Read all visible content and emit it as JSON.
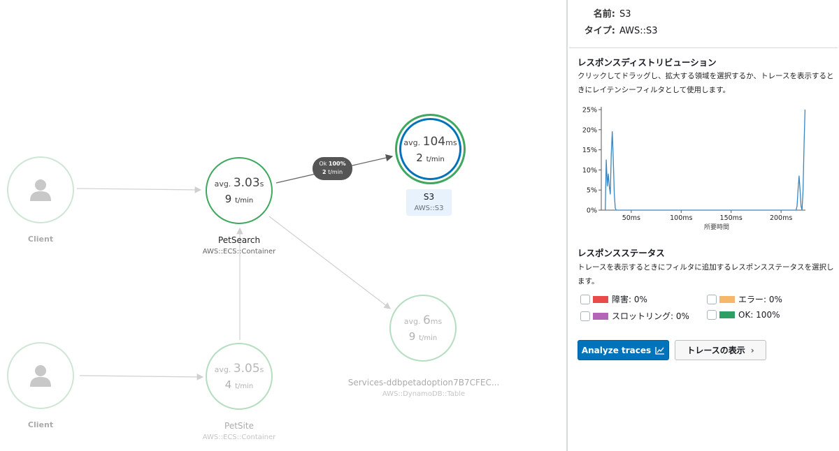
{
  "service_map": {
    "nodes": [
      {
        "id": "client1",
        "name": "Client",
        "kind": "client"
      },
      {
        "id": "petsearch",
        "name": "PetSearch",
        "type": "AWS::ECS::Container",
        "avg_value": "3.03",
        "avg_unit": "s",
        "tpm": "9",
        "tpm_unit": "t/min"
      },
      {
        "id": "s3",
        "name": "S3",
        "type": "AWS::S3",
        "avg_value": "104",
        "avg_unit": "ms",
        "tpm": "2",
        "tpm_unit": "t/min",
        "selected": true
      },
      {
        "id": "client2",
        "name": "Client",
        "kind": "client"
      },
      {
        "id": "petsite",
        "name": "PetSite",
        "type": "AWS::ECS::Container",
        "avg_value": "3.05",
        "avg_unit": "s",
        "tpm": "4",
        "tpm_unit": "t/min"
      },
      {
        "id": "ddb",
        "name": "Services-ddbpetadoption7B7CFEC...",
        "type": "AWS::DynamoDB::Table",
        "avg_value": "6",
        "avg_unit": "ms",
        "tpm": "9",
        "tpm_unit": "t/min"
      }
    ],
    "avg_prefix": "avg.",
    "edge_badge": {
      "status": "Ok",
      "percent": "100%",
      "rate": "2",
      "rate_unit": "t/min"
    },
    "colors": {
      "ok_ring": "#3fa85e",
      "selected_ring": "#0073bb",
      "faded_ring": "#cfe6d6"
    }
  },
  "panel": {
    "name_label": "名前:",
    "name_value": "S3",
    "type_label": "タイプ:",
    "type_value": "AWS::S3",
    "distribution": {
      "title": "レスポンスディストリビューション",
      "description": "クリックしてドラッグし、拡大する領域を選択するか、トレースを表示するときにレイテンシーフィルタとして使用します。"
    },
    "status": {
      "title": "レスポンスステータス",
      "description": "トレースを表示するときにフィルタに追加するレスポンスステータスを選択します。",
      "items": [
        {
          "label": "障害: 0%",
          "color": "#e94b4b"
        },
        {
          "label": "エラー: 0%",
          "color": "#f5b86b"
        },
        {
          "label": "スロットリング: 0%",
          "color": "#b565b8"
        },
        {
          "label": "OK: 100%",
          "color": "#2f9e65"
        }
      ]
    },
    "analyze_button": "Analyze traces",
    "view_traces_button": "トレースの表示"
  },
  "chart_data": {
    "type": "line",
    "xlabel": "所要時間",
    "ylabel": "",
    "x_ticks": [
      "50ms",
      "100ms",
      "150ms",
      "200ms"
    ],
    "x_tick_values": [
      50,
      100,
      150,
      200
    ],
    "y_ticks": [
      "0%",
      "5%",
      "10%",
      "15%",
      "20%",
      "25%"
    ],
    "y_tick_values": [
      0,
      5,
      10,
      15,
      20,
      25
    ],
    "xlim": [
      20,
      230
    ],
    "ylim": [
      0,
      25
    ],
    "grid": false,
    "series": [
      {
        "color": "#3a85c0",
        "x": [
          24,
          25,
          26,
          27,
          28,
          29,
          30,
          31,
          32,
          33,
          34,
          35,
          40,
          60,
          100,
          150,
          200,
          215,
          216,
          217,
          218,
          219,
          220,
          221,
          222,
          223,
          224
        ],
        "y": [
          0,
          12.5,
          6,
          9,
          6,
          4,
          14,
          19.5,
          13,
          4,
          0.5,
          0,
          0,
          0,
          0,
          0,
          0,
          0,
          1,
          5,
          8.5,
          5,
          1,
          0,
          5,
          16,
          25
        ]
      }
    ]
  }
}
